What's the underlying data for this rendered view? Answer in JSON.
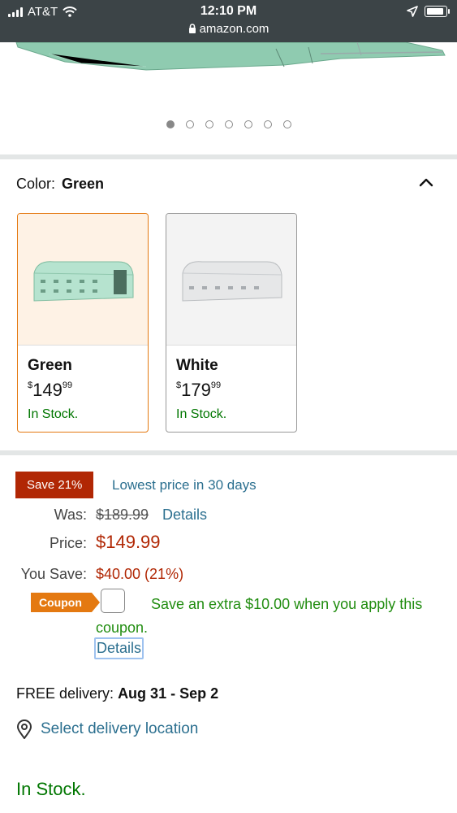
{
  "status_bar": {
    "carrier": "AT&T",
    "time": "12:10 PM",
    "url": "amazon.com"
  },
  "carousel": {
    "dot_count": 7,
    "active_index": 0
  },
  "color_selector": {
    "label": "Color:",
    "selected": "Green",
    "options": [
      {
        "name": "Green",
        "price_currency": "$",
        "price_whole": "149",
        "price_fraction": "99",
        "availability": "In Stock."
      },
      {
        "name": "White",
        "price_currency": "$",
        "price_whole": "179",
        "price_fraction": "99",
        "availability": "In Stock."
      }
    ]
  },
  "pricing": {
    "save_badge": "Save 21%",
    "lowest_note": "Lowest price in 30 days",
    "was_label": "Was:",
    "was_value": "$189.99",
    "details_link": "Details",
    "price_label": "Price:",
    "price_value": "$149.99",
    "you_save_label": "You Save:",
    "you_save_value": "$40.00 (21%)"
  },
  "coupon": {
    "tag": "Coupon",
    "text": "Save an extra $10.00 when you apply this coupon.",
    "details": "Details"
  },
  "delivery": {
    "prefix": "FREE delivery:",
    "dates": "Aug 31 - Sep 2",
    "select_location": "Select delivery location"
  },
  "availability": "In Stock.",
  "colors": {
    "link": "#2b6f8f",
    "price_red": "#b12704",
    "stock_green": "#007600",
    "coupon_orange": "#e47911",
    "selected_border": "#e47911"
  }
}
